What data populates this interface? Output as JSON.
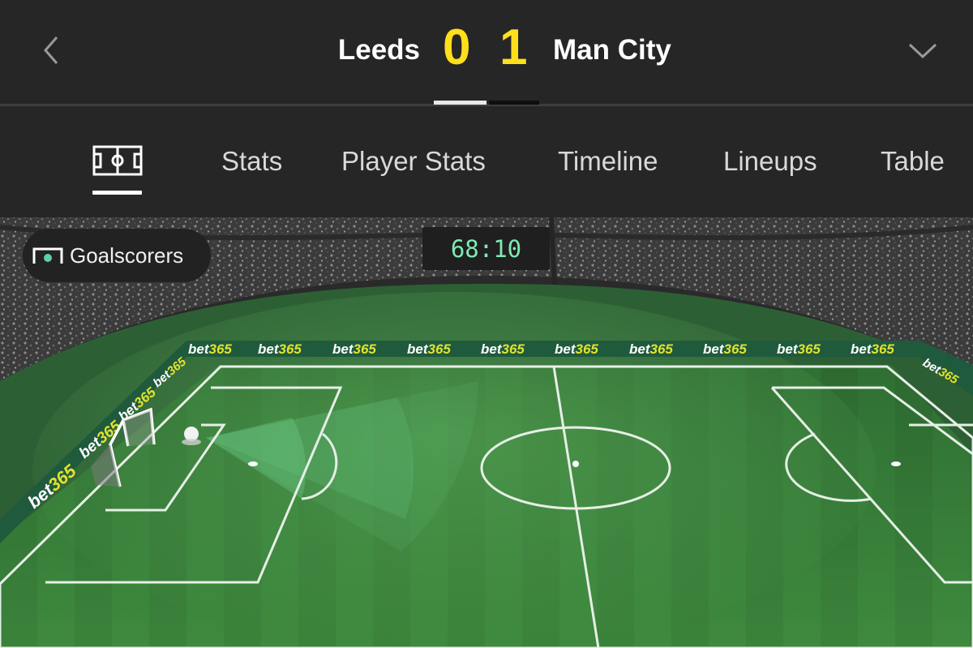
{
  "header": {
    "back_icon": "chevron-left-icon",
    "dropdown_icon": "chevron-down-icon",
    "home_team": "Leeds",
    "away_team": "Man City",
    "home_score": "0",
    "away_score": "1"
  },
  "tabs": {
    "pitch_icon": "pitch-icon",
    "items": [
      {
        "label": "Stats"
      },
      {
        "label": "Player Stats"
      },
      {
        "label": "Timeline"
      },
      {
        "label": "Lineups"
      },
      {
        "label": "Table"
      }
    ]
  },
  "match_view": {
    "goalscorers_label": "Goalscorers",
    "goalscorers_icon": "goal-icon",
    "clock": "68:10",
    "board_text": "bet365"
  },
  "colors": {
    "background": "#262626",
    "score": "#ffdf1b",
    "clock": "#7ee9b3",
    "pitch": "#3f8a3e",
    "board": "#1f5a3d",
    "board_accent": "#e3e22e"
  }
}
